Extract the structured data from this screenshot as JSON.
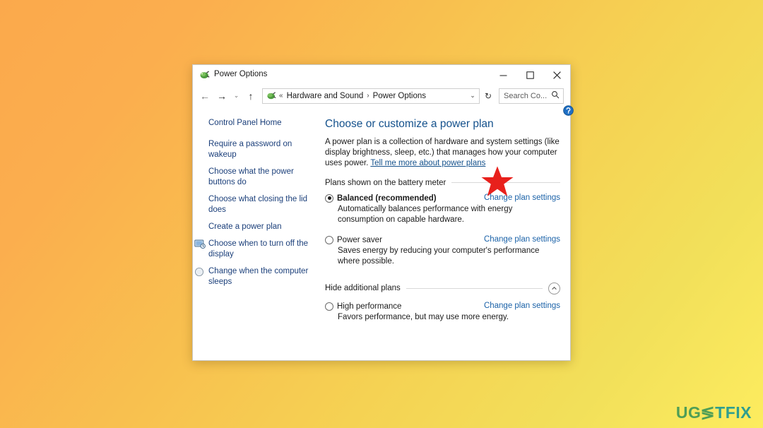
{
  "desktop": {
    "background_top_left": "#fba94c",
    "background_bottom_right": "#fdec5f",
    "watermark": {
      "part1": "UG",
      "part2": "≶",
      "part3": "TFIX",
      "color_green": "#4f9e56",
      "color_teal": "#2f9e8f"
    }
  },
  "window": {
    "title": "Power Options",
    "title_icon": "power-plug-icon",
    "controls": {
      "minimize": "minimize-icon",
      "maximize": "maximize-icon",
      "close": "close-icon"
    },
    "nav": {
      "back": "←",
      "forward": "→",
      "recent": "⌄",
      "up": "↑",
      "refresh": "↻"
    },
    "address": {
      "icon": "power-plug-icon",
      "prefix": "«",
      "crumb1": "Hardware and Sound",
      "separator": "›",
      "crumb2": "Power Options",
      "dropdown": "⌄"
    },
    "search": {
      "placeholder": "Search Co...",
      "icon": "search-icon"
    }
  },
  "sidebar": {
    "home": "Control Panel Home",
    "items": [
      {
        "label": "Require a password on wakeup",
        "icon": null
      },
      {
        "label": "Choose what the power buttons do",
        "icon": null
      },
      {
        "label": "Choose what closing the lid does",
        "icon": null
      },
      {
        "label": "Create a power plan",
        "icon": null
      },
      {
        "label": "Choose when to turn off the display",
        "icon": "display-icon"
      },
      {
        "label": "Change when the computer sleeps",
        "icon": "sleep-moon-icon"
      }
    ]
  },
  "content": {
    "heading": "Choose or customize a power plan",
    "intro_text": "A power plan is a collection of hardware and system settings (like display brightness, sleep, etc.) that manages how your computer uses power. ",
    "intro_link": "Tell me more about power plans",
    "section_battery": "Plans shown on the battery meter",
    "section_additional": "Hide additional plans",
    "collapse_icon": "chevron-up-icon",
    "help_icon": "help-circle-icon",
    "plans": [
      {
        "name": "Balanced (recommended)",
        "selected": true,
        "bold": true,
        "description": "Automatically balances performance with energy consumption on capable hardware.",
        "link": "Change plan settings"
      },
      {
        "name": "Power saver",
        "selected": false,
        "bold": false,
        "description": "Saves energy by reducing your computer's performance where possible.",
        "link": "Change plan settings"
      }
    ],
    "additional_plans": [
      {
        "name": "High performance",
        "selected": false,
        "bold": false,
        "description": "Favors performance, but may use more energy.",
        "link": "Change plan settings"
      }
    ]
  },
  "annotation": {
    "shape": "red-star",
    "color": "#e8201c"
  }
}
